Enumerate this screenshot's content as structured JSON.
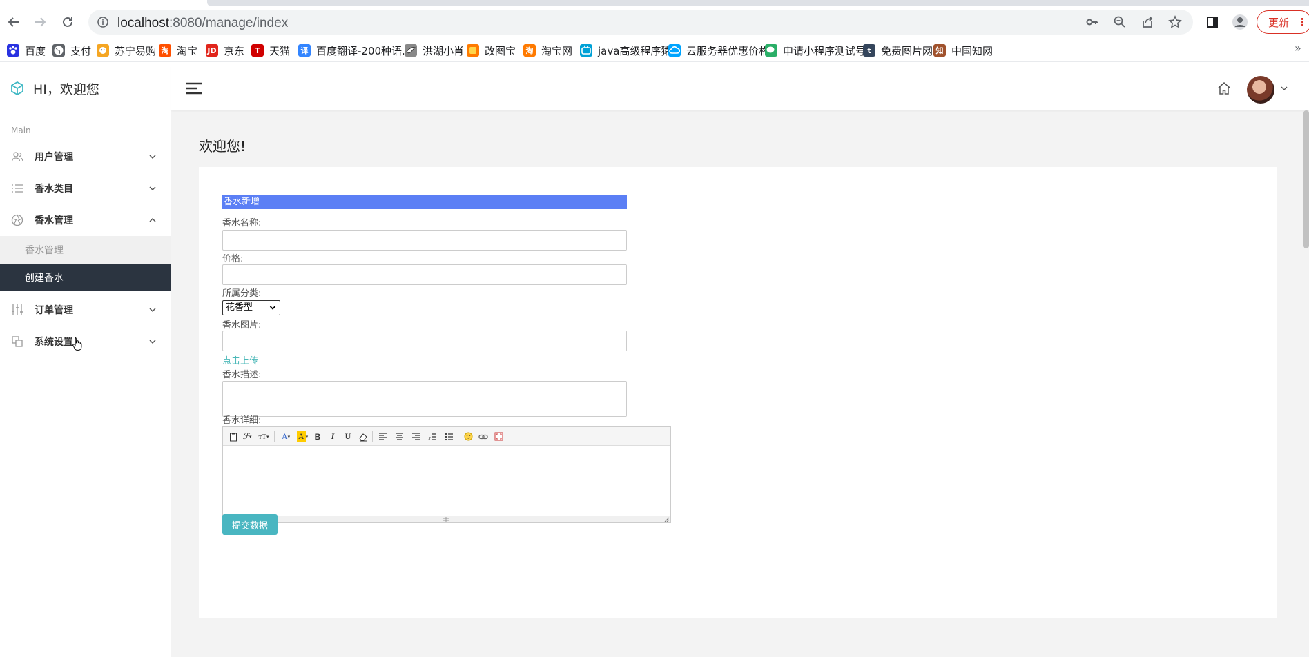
{
  "browser": {
    "url_host": "localhost",
    "url_path": ":8080/manage/index",
    "update_label": "更新",
    "update_more": "⋮",
    "bookmarks_more": "»",
    "bookmarks": [
      {
        "label": "百度",
        "icon": "paw",
        "color": "#2932e1"
      },
      {
        "label": "支付",
        "icon": "globe",
        "color": "#5f6368"
      },
      {
        "label": "苏宁易购",
        "icon": "lion",
        "color": "#f5a623"
      },
      {
        "label": "淘宝",
        "icon": "淘",
        "color": "#ff5000"
      },
      {
        "label": "京东",
        "icon": "JD",
        "color": "#e1251b"
      },
      {
        "label": "天猫",
        "icon": "T",
        "color": "#d00000"
      },
      {
        "label": "百度翻译-200种语...",
        "icon": "译",
        "color": "#3385ff"
      },
      {
        "label": "洪湖小肖",
        "icon": "bird",
        "color": "#888888"
      },
      {
        "label": "改图宝",
        "icon": "square",
        "color": "#ff7a00"
      },
      {
        "label": "淘宝网",
        "icon": "淘",
        "color": "#ff7a00"
      },
      {
        "label": "java高级程序猿",
        "icon": "tv",
        "color": "#00a1d6"
      },
      {
        "label": "云服务器优惠价格",
        "icon": "cloud",
        "color": "#00a4ff"
      },
      {
        "label": "申请小程序测试号",
        "icon": "chat",
        "color": "#2aae67"
      },
      {
        "label": "免费图片网",
        "icon": "t",
        "color": "#35465c"
      },
      {
        "label": "中国知网",
        "icon": "知",
        "color": "#a0522d"
      }
    ]
  },
  "sidebar": {
    "brand": "HI，欢迎您",
    "section": "Main",
    "menu": {
      "users": "用户管理",
      "categories": "香水类目",
      "perfume": "香水管理",
      "perfume_list": "香水管理",
      "perfume_create": "创建香水",
      "orders": "订单管理",
      "settings": "系统设置"
    }
  },
  "main": {
    "title": "欢迎您!",
    "form": {
      "header": "香水新增",
      "name_label": "香水名称:",
      "name_value": "",
      "price_label": "价格:",
      "price_value": "",
      "category_label": "所属分类:",
      "category_selected": "花香型",
      "image_label": "香水图片:",
      "image_value": "",
      "upload_label": "点击上传",
      "desc_label": "香水描述:",
      "desc_value": "",
      "detail_label": "香水详细:",
      "submit_label": "提交数据"
    },
    "editor_tools": {
      "font_size": "тT",
      "bold": "B",
      "italic": "I",
      "underline": "U"
    }
  },
  "colors": {
    "sidebar_active": "#2b3440",
    "form_header": "#5b7ff5",
    "submit": "#49b6c1",
    "link": "#4bb8b8"
  }
}
